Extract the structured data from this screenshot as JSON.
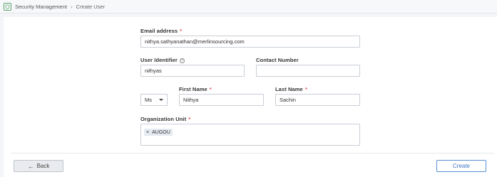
{
  "breadcrumb": {
    "root": "Security Management",
    "current": "Create User"
  },
  "form": {
    "email": {
      "label": "Email address",
      "value": "nithya.sathyanathan@merlinsourcing.com",
      "required": true
    },
    "user_identifier": {
      "label": "User Identifier",
      "value": "nithyas",
      "help_icon": "?"
    },
    "contact_number": {
      "label": "Contact Number",
      "value": ""
    },
    "salutation": {
      "value": "Ms"
    },
    "first_name": {
      "label": "First Name",
      "value": "Nithya",
      "required": true
    },
    "last_name": {
      "label": "Last Name",
      "value": "Sachin",
      "required": true
    },
    "organization_unit": {
      "label": "Organization Unit",
      "required": true,
      "tags": [
        {
          "label": "AUGOU",
          "remove": "×"
        }
      ]
    },
    "required_marker": "*"
  },
  "actions": {
    "back_label": "Back",
    "back_icon": "arrow-left",
    "create_label": "Create"
  },
  "colors": {
    "accent": "#3d74c4",
    "required": "#e05252",
    "logo": "#5aa36e"
  }
}
